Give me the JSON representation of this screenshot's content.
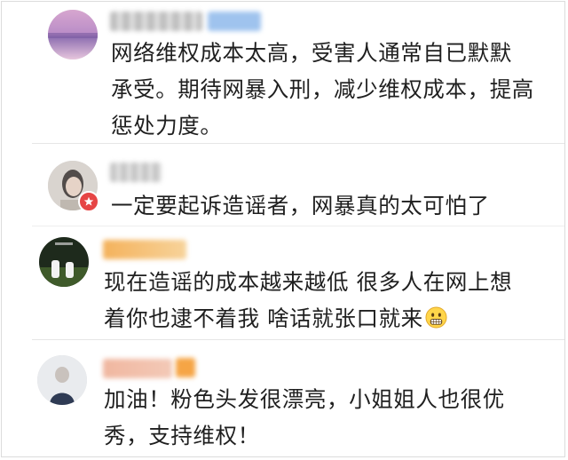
{
  "comments": [
    {
      "lines": [
        "网络维权成本太高，受害人通常自已默默",
        "承受。期待网暴入刑，减少维权成本，提高",
        "惩处力度。"
      ]
    },
    {
      "lines": [
        "一定要起诉造谣者，网暴真的太可怕了"
      ]
    },
    {
      "lines": [
        "现在造谣的成本越来越低 很多人在网上想",
        "着你也逮不着我 啥话就张口就来"
      ],
      "emoji": "grimacing-emoji"
    },
    {
      "lines": [
        "加油！粉色头发很漂亮，小姐姐人也很优",
        "秀，支持维权！"
      ]
    }
  ],
  "colors": {
    "badge_red": "#e64545",
    "name_blur_blue": "#9fc3ee",
    "name_blur_orange": "#f4b25c",
    "name_blur_pink": "#f0b7a0"
  }
}
